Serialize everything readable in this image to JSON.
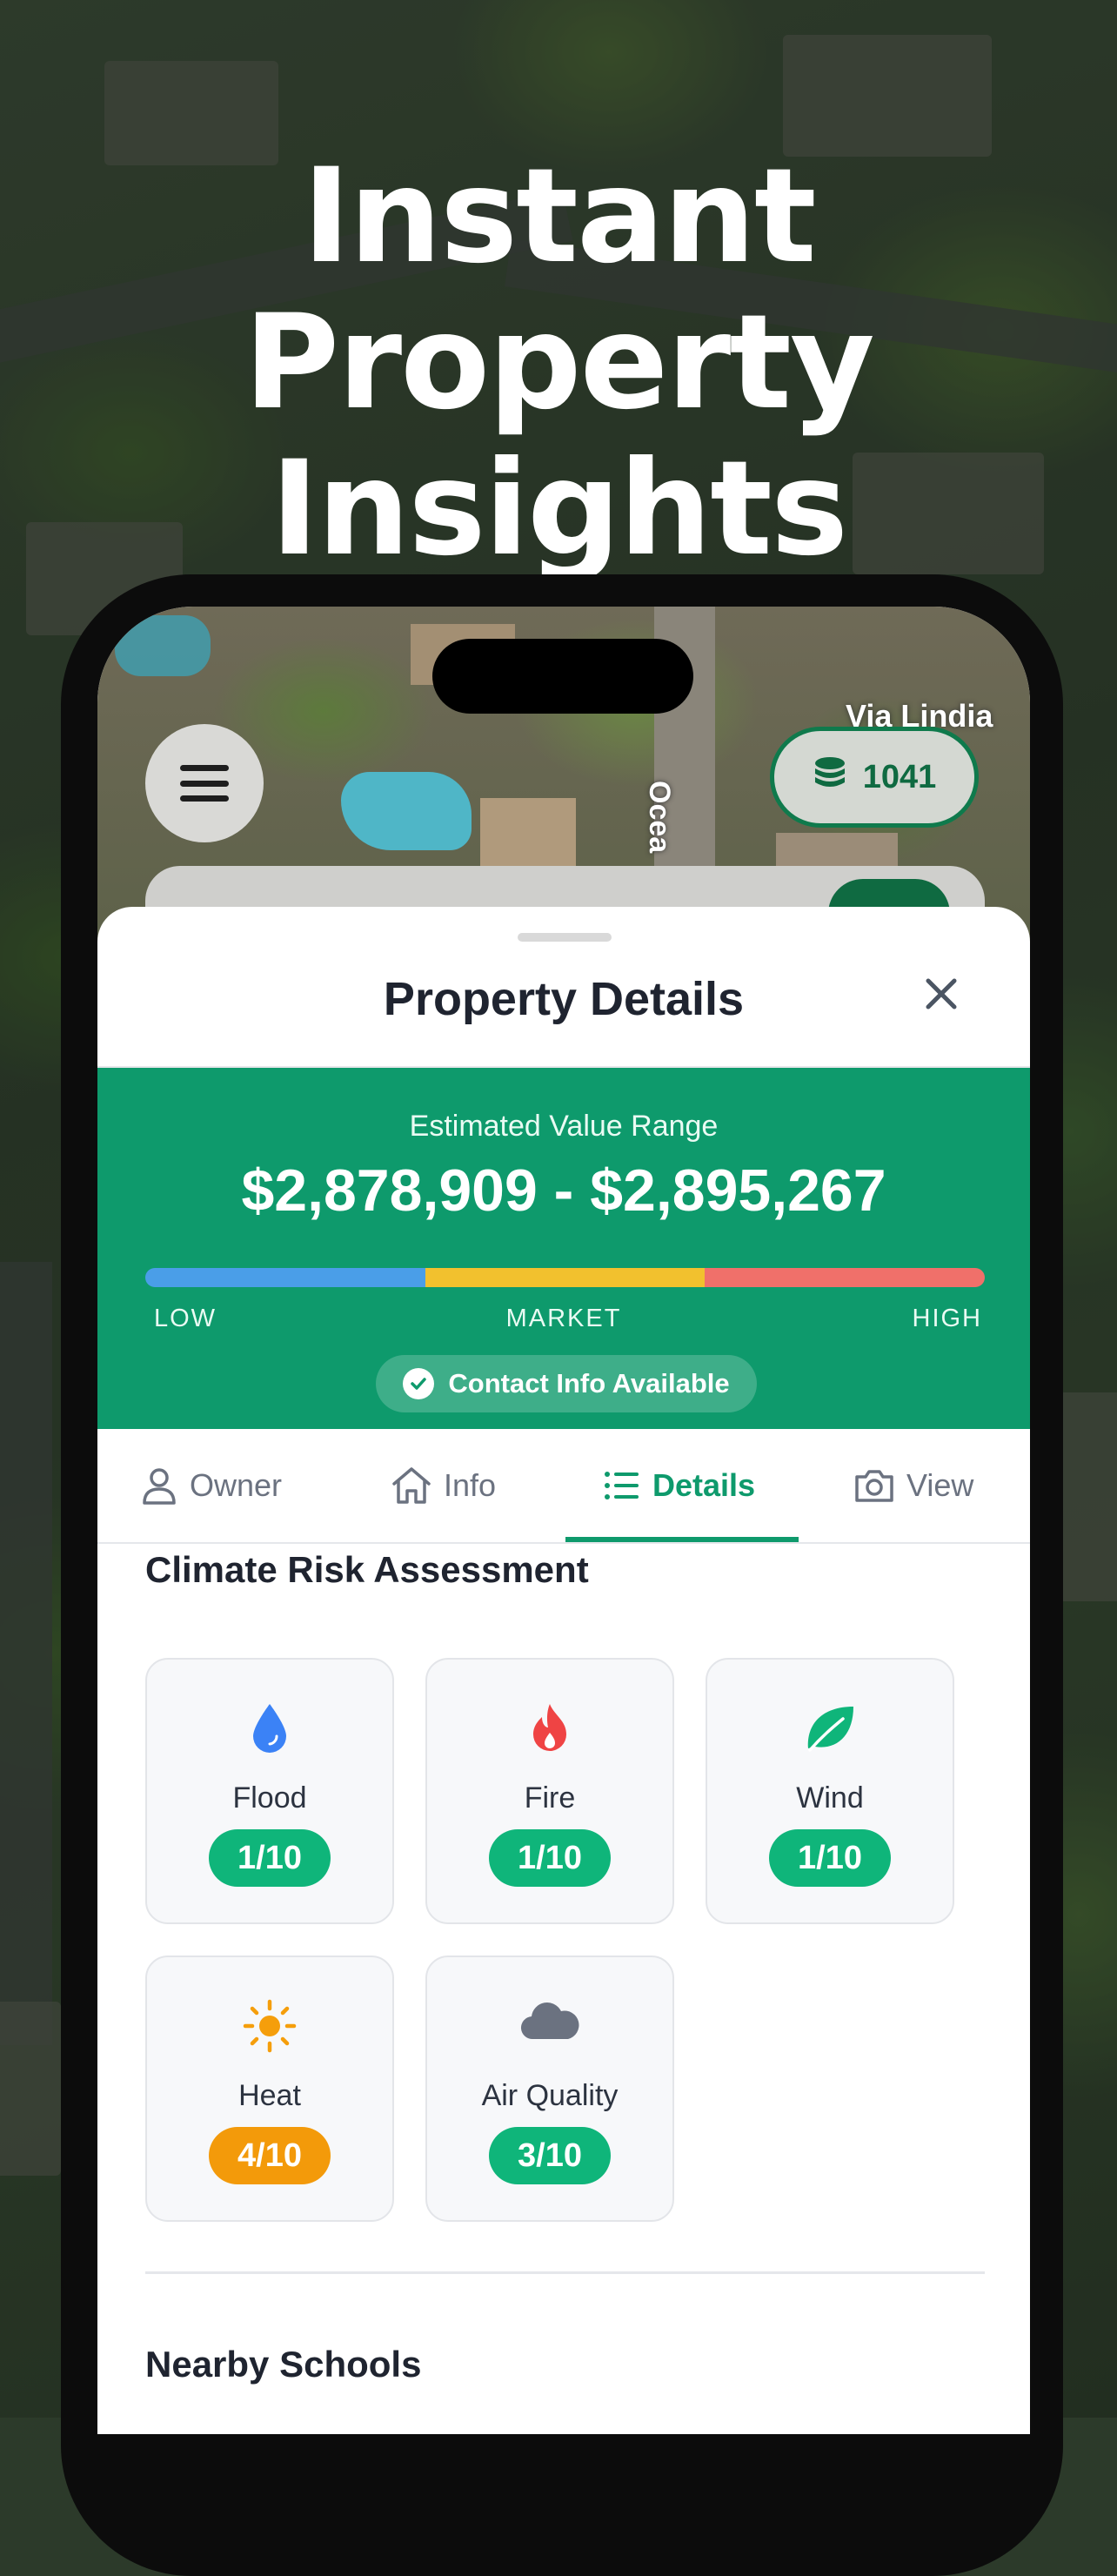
{
  "headline": {
    "line1": "Instant Property",
    "line2": "Insights"
  },
  "map": {
    "street_1": "Via Lindia",
    "street_2": "Ocea"
  },
  "credits": {
    "value": "1041",
    "icon": "coins-stack-icon"
  },
  "sheet": {
    "title": "Property Details"
  },
  "value": {
    "label": "Estimated Value Range",
    "range": "$2,878,909 - $2,895,267",
    "scale_low": "LOW",
    "scale_market": "MARKET",
    "scale_high": "HIGH",
    "contact_chip": "Contact Info Available",
    "colors": {
      "panel": "#0e9a6c",
      "low": "#4a9ee8",
      "market": "#f2c12e",
      "high": "#f0706a"
    }
  },
  "tabs": [
    {
      "label": "Owner",
      "icon": "person-icon"
    },
    {
      "label": "Info",
      "icon": "home-icon"
    },
    {
      "label": "Details",
      "icon": "list-icon",
      "active": true
    },
    {
      "label": "View",
      "icon": "camera-icon"
    }
  ],
  "climate": {
    "title": "Climate Risk Assessment",
    "items": [
      {
        "name": "Flood",
        "score": "1/10",
        "icon": "water-drop-icon"
      },
      {
        "name": "Fire",
        "score": "1/10",
        "icon": "fire-icon"
      },
      {
        "name": "Wind",
        "score": "1/10",
        "icon": "leaf-icon"
      },
      {
        "name": "Heat",
        "score": "4/10",
        "icon": "sun-icon"
      },
      {
        "name": "Air Quality",
        "score": "3/10",
        "icon": "cloud-icon"
      }
    ]
  },
  "schools": {
    "title": "Nearby Schools"
  }
}
